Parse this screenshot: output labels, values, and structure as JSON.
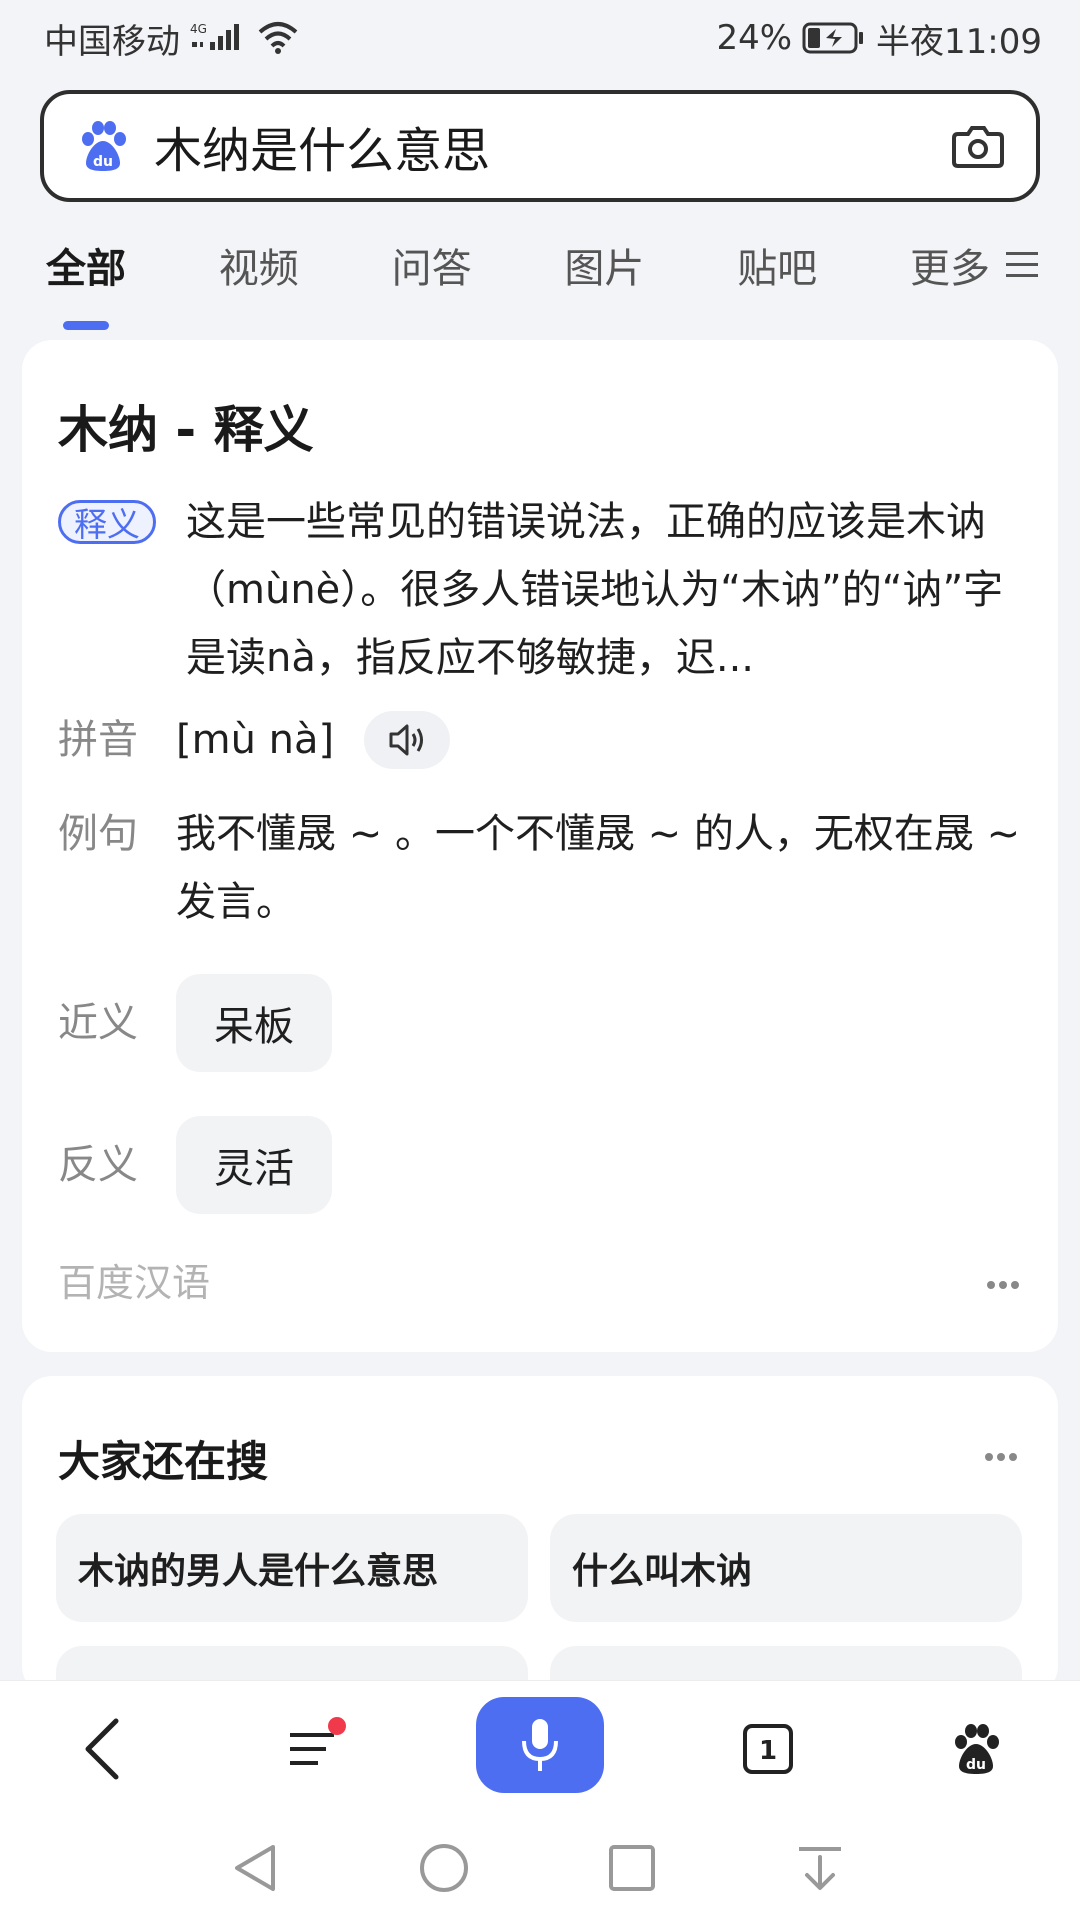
{
  "status_bar": {
    "carrier": "中国移动",
    "network": "4G",
    "battery": "24%",
    "time": "半夜11:09"
  },
  "search": {
    "query": "木纳是什么意思"
  },
  "tabs": [
    {
      "label": "全部",
      "active": true
    },
    {
      "label": "视频",
      "active": false
    },
    {
      "label": "问答",
      "active": false
    },
    {
      "label": "图片",
      "active": false
    },
    {
      "label": "贴吧",
      "active": false
    },
    {
      "label": "更多",
      "active": false
    }
  ],
  "definition_card": {
    "title": "木纳 - 释义",
    "definition_badge": "释义",
    "definition_text": "这是一些常见的错误说法，正确的应该是木讷（mùnè）。很多人错误地认为“木讷”的“讷”字是读nà，指反应不够敏捷，迟...",
    "pinyin_label": "拼音",
    "pinyin_value": "[mù nà]",
    "example_label": "例句",
    "example_text": "我不懂晟 ~ 。一个不懂晟 ~ 的人，无权在晟 ~ 发言。",
    "synonym_label": "近义",
    "synonym": "呆板",
    "antonym_label": "反义",
    "antonym": "灵活",
    "source": "百度汉语"
  },
  "related": {
    "title": "大家还在搜",
    "items": [
      "木讷的男人是什么意思",
      "什么叫木讷"
    ]
  },
  "toolbar": {
    "tabs_count": "1"
  },
  "colors": {
    "accent": "#4e6ef2",
    "notification_dot": "#f03a4b",
    "background": "#f3f4f7"
  }
}
